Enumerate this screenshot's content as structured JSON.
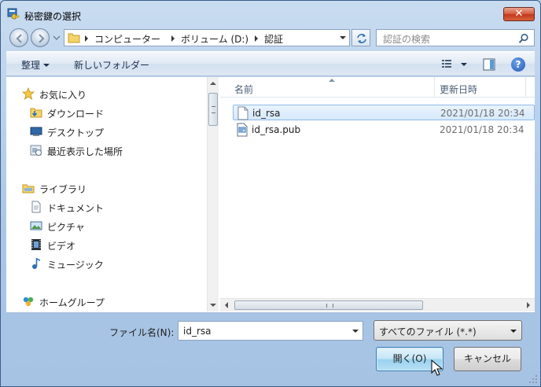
{
  "window": {
    "title": "秘密鍵の選択",
    "close_label": "✕"
  },
  "address": {
    "crumbs": [
      "コンピューター",
      "ボリューム (D:)",
      "認証"
    ]
  },
  "search": {
    "placeholder": "認証の検索"
  },
  "toolbar": {
    "organize": "整理",
    "new_folder": "新しいフォルダー",
    "help": "?"
  },
  "nav": {
    "items": [
      {
        "label": "お気に入り",
        "icon": "star-icon"
      },
      {
        "label": "ダウンロード",
        "icon": "downloads-folder-icon"
      },
      {
        "label": "デスクトップ",
        "icon": "desktop-icon"
      },
      {
        "label": "最近表示した場所",
        "icon": "recent-places-icon"
      },
      {
        "label": "ライブラリ",
        "icon": "library-icon"
      },
      {
        "label": "ドキュメント",
        "icon": "documents-icon"
      },
      {
        "label": "ピクチャ",
        "icon": "pictures-icon"
      },
      {
        "label": "ビデオ",
        "icon": "videos-icon"
      },
      {
        "label": "ミュージック",
        "icon": "music-icon"
      },
      {
        "label": "ホームグループ",
        "icon": "homegroup-icon"
      }
    ]
  },
  "files": {
    "columns": {
      "name": "名前",
      "date": "更新日時"
    },
    "rows": [
      {
        "name": "id_rsa",
        "date": "2021/01/18 20:34",
        "selected": true
      },
      {
        "name": "id_rsa.pub",
        "date": "2021/01/18 20:34",
        "selected": false
      }
    ]
  },
  "footer": {
    "filename_label": "ファイル名(N):",
    "filename_value": "id_rsa",
    "filter_value": "すべてのファイル (*.*)",
    "open_label": "開く(O)",
    "cancel_label": "キャンセル"
  },
  "colors": {
    "accent": "#3c7fb1",
    "selection": "#d6e9fc",
    "close": "#c2381b"
  }
}
